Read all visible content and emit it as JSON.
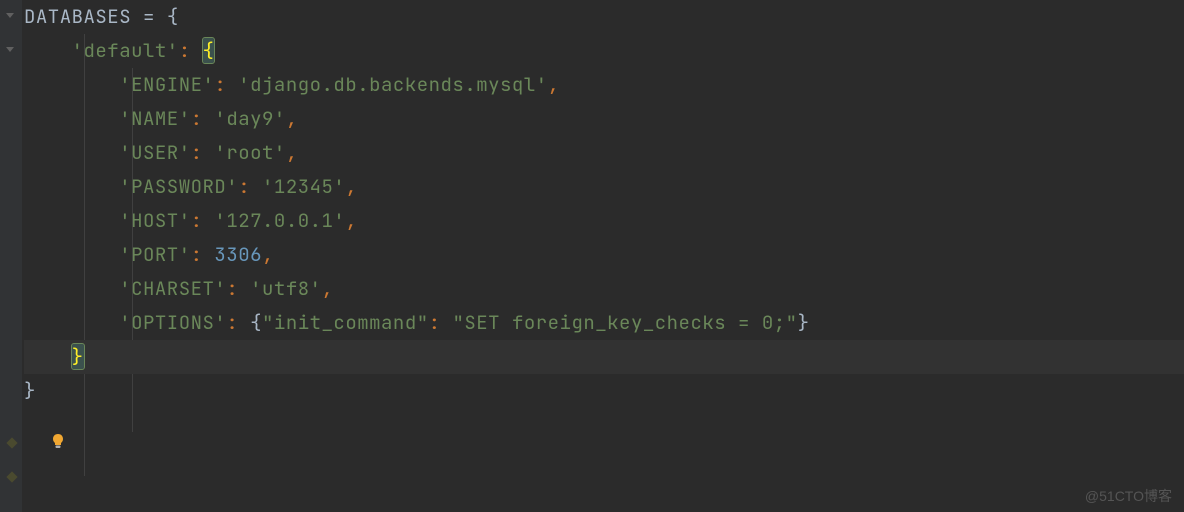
{
  "code": {
    "var_name": "DATABASES",
    "eq": " = ",
    "open_brace": "{",
    "default_key": "'default'",
    "colon": ":",
    "open_brace2": "{",
    "entries": [
      {
        "key": "'ENGINE'",
        "value": "'django.db.backends.mysql'",
        "type": "str"
      },
      {
        "key": "'NAME'",
        "value": "'day9'",
        "type": "str"
      },
      {
        "key": "'USER'",
        "value": "'root'",
        "type": "str"
      },
      {
        "key": "'PASSWORD'",
        "value": "'12345'",
        "type": "str"
      },
      {
        "key": "'HOST'",
        "value": "'127.0.0.1'",
        "type": "str"
      },
      {
        "key": "'PORT'",
        "value": "3306",
        "type": "num"
      },
      {
        "key": "'CHARSET'",
        "value": "'utf8'",
        "type": "str"
      }
    ],
    "options_key": "'OPTIONS'",
    "options_open": "{",
    "options_inner_key": "\"init_command\"",
    "options_inner_val": "\"SET foreign_key_checks = 0;\"",
    "options_close": "}",
    "close_brace_inner": "}",
    "close_brace_outer": "}",
    "comma": ","
  },
  "watermark": "@51CTO博客"
}
